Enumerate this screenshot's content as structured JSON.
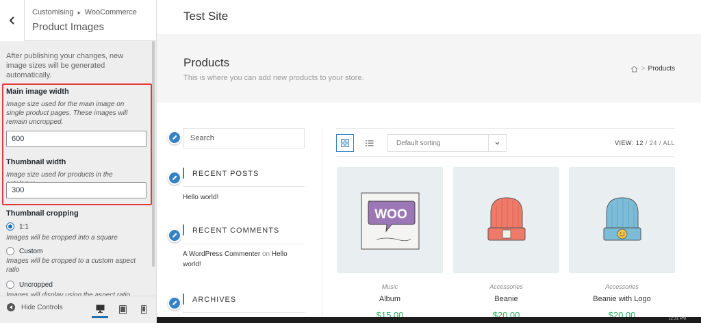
{
  "sidebar": {
    "breadcrumb_parent": "Customising",
    "breadcrumb_sep": "▸",
    "breadcrumb_section": "WooCommerce",
    "panel_title": "Product Images",
    "note": "After publishing your changes, new image sizes will be generated automatically.",
    "main_image": {
      "label": "Main image width",
      "description": "Image size used for the main image on single product pages. These images will remain uncropped.",
      "value": "600"
    },
    "thumbnail": {
      "label": "Thumbnail width",
      "description": "Image size used for products in the catalogue.",
      "value": "300"
    },
    "cropping": {
      "label": "Thumbnail cropping",
      "options": [
        {
          "label": "1:1",
          "description": "Images will be cropped into a square",
          "checked": true
        },
        {
          "label": "Custom",
          "description": "Images will be cropped to a custom aspect ratio",
          "checked": false
        },
        {
          "label": "Uncropped",
          "description": "Images will display using the aspect ratio",
          "checked": false
        }
      ]
    },
    "footer": {
      "hide_controls": "Hide Controls",
      "active_device": "desktop"
    }
  },
  "site": {
    "title": "Test Site",
    "page_title": "Products",
    "page_description": "This is where you can add new products to your store.",
    "breadcrumb_current": "Products",
    "search_placeholder": "Search",
    "widgets": {
      "recent_posts_title": "RECENT POSTS",
      "recent_posts": [
        "Hello world!"
      ],
      "recent_comments_title": "RECENT COMMENTS",
      "comment_author": "A WordPress Commenter",
      "comment_on": "on",
      "comment_post_1": "Hello",
      "comment_post_2": "world!",
      "archives_title": "ARCHIVES"
    },
    "toolbar": {
      "sorting": "Default sorting",
      "view_label": "VIEW:",
      "view_selected": "12",
      "view_sep": "/",
      "view_opt_1": "24",
      "view_opt_2": "ALL"
    },
    "products": [
      {
        "category": "Music",
        "name": "Album",
        "price": "$15.00",
        "image": "woo-album-icon"
      },
      {
        "category": "Accessories",
        "name": "Beanie",
        "price": "$20.00",
        "image": "orange-beanie-icon"
      },
      {
        "category": "Accessories",
        "name": "Beanie with Logo",
        "price": "$20.00",
        "image": "blue-beanie-logo-icon"
      }
    ]
  },
  "colors": {
    "accent": "#3582c4",
    "highlight_box": "#e03c3c",
    "price": "#27ae60"
  },
  "taskbar_clock": "12:31 PM"
}
